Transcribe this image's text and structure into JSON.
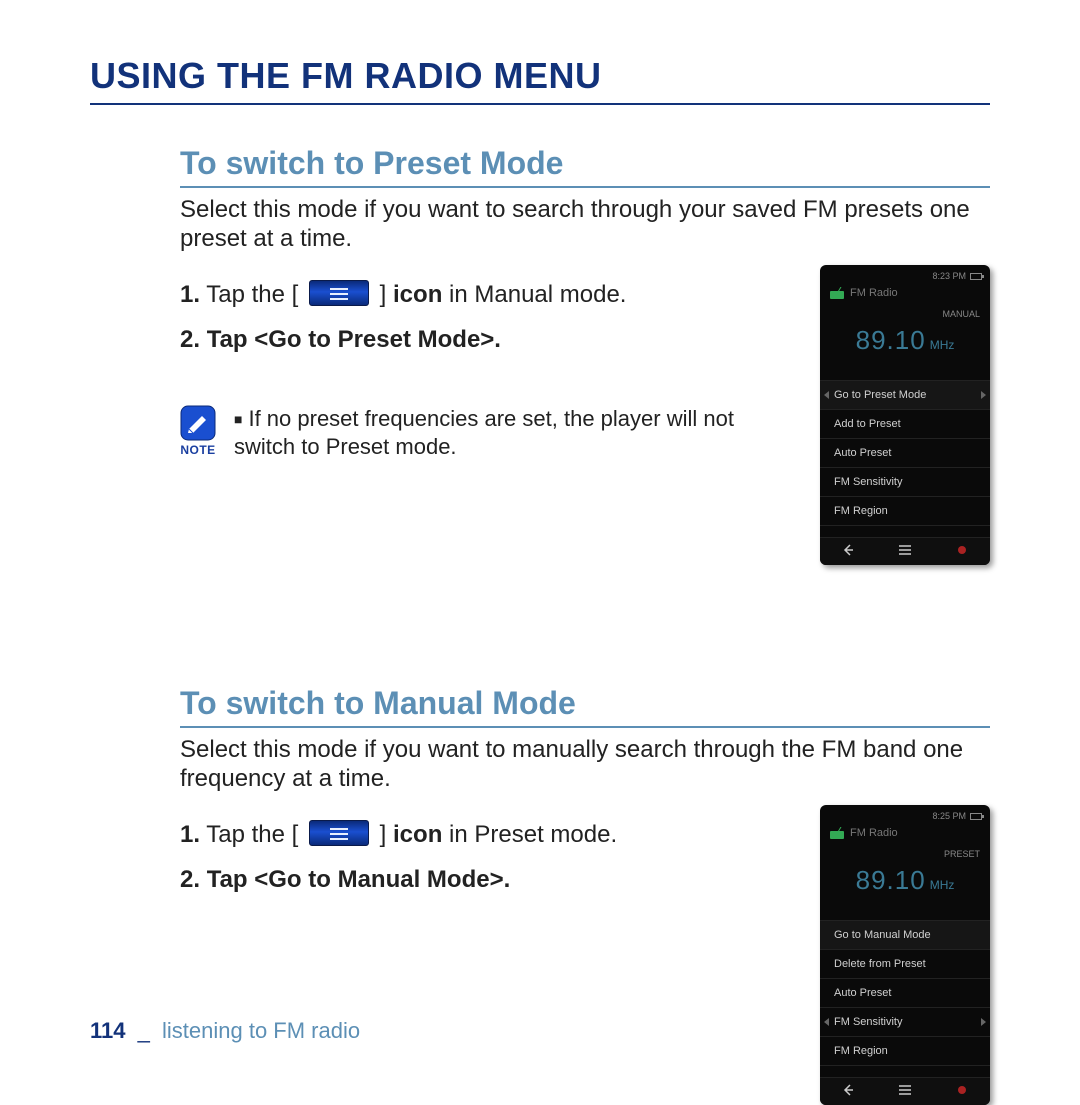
{
  "page_title": "USING THE FM RADIO MENU",
  "sections": [
    {
      "heading": "To switch to Preset Mode",
      "desc": "Select this mode if you want to search through your saved FM presets one preset at a time.",
      "step1_pre": "Tap the ",
      "step1_bracket_open": "[ ",
      "step1_bracket_close": " ]",
      "step1_icon_label": " icon",
      "step1_post": " in Manual mode.",
      "step2": "Tap <Go to Preset Mode>.",
      "note_label": "NOTE",
      "note_text": "If no preset frequencies are set, the player will not switch to Preset mode.",
      "device": {
        "time": "8:23 PM",
        "app_title": "FM Radio",
        "mode": "MANUAL",
        "freq": "89.10",
        "unit": "MHz",
        "menu": [
          "Go to Preset Mode",
          "Add to Preset",
          "Auto Preset",
          "FM Sensitivity",
          "FM Region"
        ],
        "selected_index": 0,
        "arrows_index": 0
      }
    },
    {
      "heading": "To switch to Manual Mode",
      "desc": "Select this mode if you want to manually search through the FM band one frequency at a time.",
      "step1_pre": "Tap the ",
      "step1_bracket_open": "[ ",
      "step1_bracket_close": " ]",
      "step1_icon_label": " icon",
      "step1_post": " in Preset mode.",
      "step2": "Tap <Go to Manual Mode>.",
      "device": {
        "time": "8:25 PM",
        "app_title": "FM Radio",
        "mode": "PRESET",
        "freq": "89.10",
        "unit": "MHz",
        "menu": [
          "Go to Manual Mode",
          "Delete from Preset",
          "Auto Preset",
          "FM Sensitivity",
          "FM Region"
        ],
        "selected_index": 0,
        "arrows_index": 3
      }
    }
  ],
  "footer": {
    "page": "114",
    "sep": "_",
    "chapter": "listening to FM radio"
  }
}
